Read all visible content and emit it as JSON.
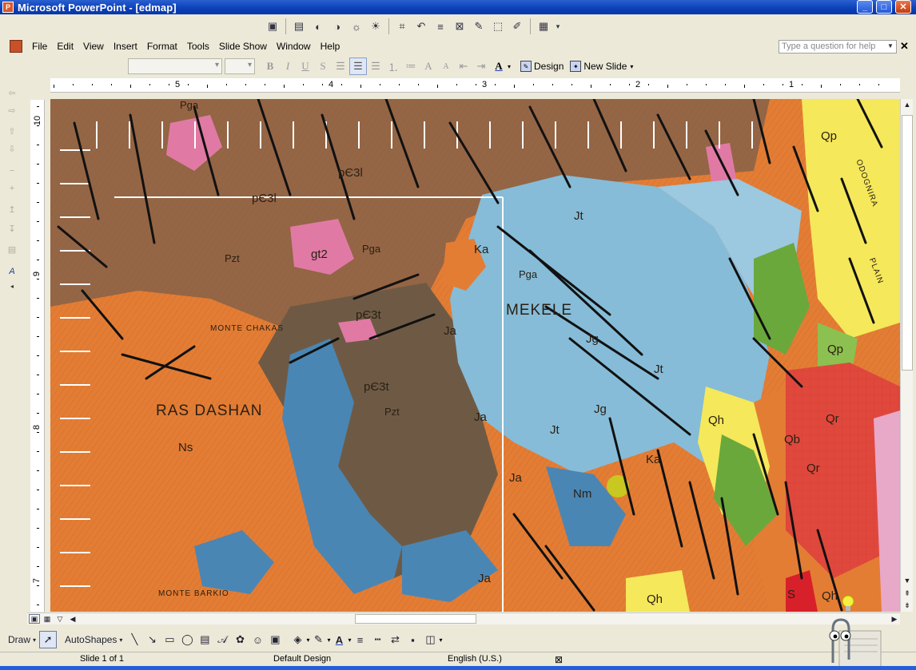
{
  "window": {
    "title": "Microsoft PowerPoint - [edmap]",
    "app_icon_glyph": "P"
  },
  "menu": {
    "items": [
      {
        "label": "File"
      },
      {
        "label": "Edit"
      },
      {
        "label": "View"
      },
      {
        "label": "Insert"
      },
      {
        "label": "Format"
      },
      {
        "label": "Tools"
      },
      {
        "label": "Slide Show"
      },
      {
        "label": "Window"
      },
      {
        "label": "Help"
      }
    ],
    "help_placeholder": "Type a question for help"
  },
  "format_toolbar": {
    "font_name": "",
    "font_size": "",
    "design_label": "Design",
    "new_slide_label": "New Slide"
  },
  "ruler": {
    "horizontal_numbers": [
      "5",
      "4",
      "3",
      "2",
      "1"
    ],
    "vertical_numbers": [
      "10",
      "9",
      "8",
      "7"
    ]
  },
  "map": {
    "labels": [
      {
        "text": "RAS DASHAN"
      },
      {
        "text": "MONTE CHAKAS"
      },
      {
        "text": "MEKELE"
      },
      {
        "text": "MONTE BARKIO"
      },
      {
        "text": "ODOGNIRA"
      },
      {
        "text": "PLAIN"
      },
      {
        "text": "Ns"
      },
      {
        "text": "Jg"
      },
      {
        "text": "Jg"
      },
      {
        "text": "Jt"
      },
      {
        "text": "Jt"
      },
      {
        "text": "Jt"
      },
      {
        "text": "Ja"
      },
      {
        "text": "Ja"
      },
      {
        "text": "Ja"
      },
      {
        "text": "Ja"
      },
      {
        "text": "Nm"
      },
      {
        "text": "Ka"
      },
      {
        "text": "Qh"
      },
      {
        "text": "Qh"
      },
      {
        "text": "Qr"
      },
      {
        "text": "Qr"
      },
      {
        "text": "Qb"
      },
      {
        "text": "Qp"
      },
      {
        "text": "Qp"
      },
      {
        "text": "Pga"
      },
      {
        "text": "Pga"
      },
      {
        "text": "Pga"
      },
      {
        "text": "Pzt"
      },
      {
        "text": "Pzt"
      },
      {
        "text": "pЄ3l"
      },
      {
        "text": "pЄ3l"
      },
      {
        "text": "pЄ3t"
      },
      {
        "text": "pЄ3t"
      },
      {
        "text": "gt2"
      },
      {
        "text": "Ka"
      },
      {
        "text": "S"
      },
      {
        "text": "Qh"
      }
    ]
  },
  "drawing_toolbar": {
    "draw_label": "Draw",
    "autoshapes_label": "AutoShapes"
  },
  "statusbar": {
    "slide_info": "Slide 1 of 1",
    "design_name": "Default Design",
    "language": "English (U.S.)"
  },
  "colors": {
    "title_bar": "#0a3fb8",
    "chrome": "#ece9d8",
    "map_orange": "#e37d34",
    "map_blue": "#86bcd8",
    "map_brown": "#8a6448"
  }
}
